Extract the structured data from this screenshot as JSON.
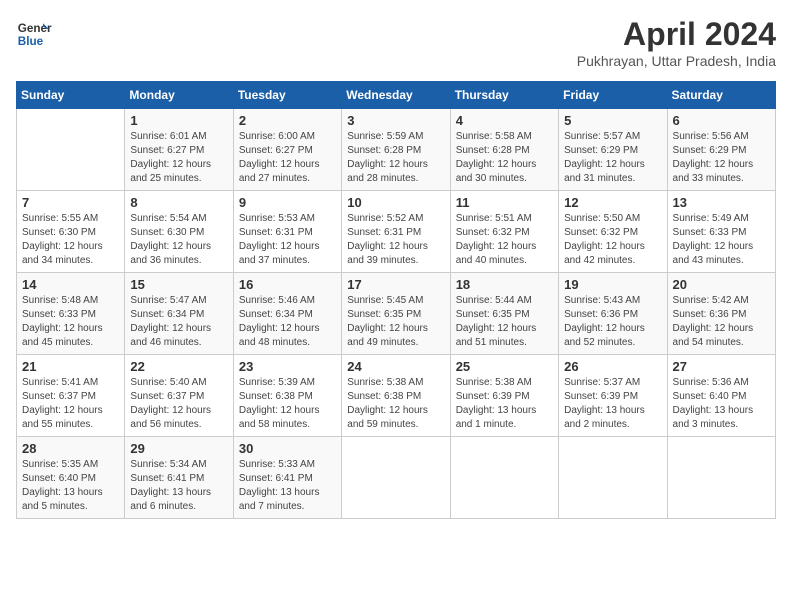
{
  "header": {
    "logo_line1": "General",
    "logo_line2": "Blue",
    "month_title": "April 2024",
    "subtitle": "Pukhrayan, Uttar Pradesh, India"
  },
  "days_of_week": [
    "Sunday",
    "Monday",
    "Tuesday",
    "Wednesday",
    "Thursday",
    "Friday",
    "Saturday"
  ],
  "weeks": [
    [
      {
        "num": "",
        "info": ""
      },
      {
        "num": "1",
        "info": "Sunrise: 6:01 AM\nSunset: 6:27 PM\nDaylight: 12 hours\nand 25 minutes."
      },
      {
        "num": "2",
        "info": "Sunrise: 6:00 AM\nSunset: 6:27 PM\nDaylight: 12 hours\nand 27 minutes."
      },
      {
        "num": "3",
        "info": "Sunrise: 5:59 AM\nSunset: 6:28 PM\nDaylight: 12 hours\nand 28 minutes."
      },
      {
        "num": "4",
        "info": "Sunrise: 5:58 AM\nSunset: 6:28 PM\nDaylight: 12 hours\nand 30 minutes."
      },
      {
        "num": "5",
        "info": "Sunrise: 5:57 AM\nSunset: 6:29 PM\nDaylight: 12 hours\nand 31 minutes."
      },
      {
        "num": "6",
        "info": "Sunrise: 5:56 AM\nSunset: 6:29 PM\nDaylight: 12 hours\nand 33 minutes."
      }
    ],
    [
      {
        "num": "7",
        "info": "Sunrise: 5:55 AM\nSunset: 6:30 PM\nDaylight: 12 hours\nand 34 minutes."
      },
      {
        "num": "8",
        "info": "Sunrise: 5:54 AM\nSunset: 6:30 PM\nDaylight: 12 hours\nand 36 minutes."
      },
      {
        "num": "9",
        "info": "Sunrise: 5:53 AM\nSunset: 6:31 PM\nDaylight: 12 hours\nand 37 minutes."
      },
      {
        "num": "10",
        "info": "Sunrise: 5:52 AM\nSunset: 6:31 PM\nDaylight: 12 hours\nand 39 minutes."
      },
      {
        "num": "11",
        "info": "Sunrise: 5:51 AM\nSunset: 6:32 PM\nDaylight: 12 hours\nand 40 minutes."
      },
      {
        "num": "12",
        "info": "Sunrise: 5:50 AM\nSunset: 6:32 PM\nDaylight: 12 hours\nand 42 minutes."
      },
      {
        "num": "13",
        "info": "Sunrise: 5:49 AM\nSunset: 6:33 PM\nDaylight: 12 hours\nand 43 minutes."
      }
    ],
    [
      {
        "num": "14",
        "info": "Sunrise: 5:48 AM\nSunset: 6:33 PM\nDaylight: 12 hours\nand 45 minutes."
      },
      {
        "num": "15",
        "info": "Sunrise: 5:47 AM\nSunset: 6:34 PM\nDaylight: 12 hours\nand 46 minutes."
      },
      {
        "num": "16",
        "info": "Sunrise: 5:46 AM\nSunset: 6:34 PM\nDaylight: 12 hours\nand 48 minutes."
      },
      {
        "num": "17",
        "info": "Sunrise: 5:45 AM\nSunset: 6:35 PM\nDaylight: 12 hours\nand 49 minutes."
      },
      {
        "num": "18",
        "info": "Sunrise: 5:44 AM\nSunset: 6:35 PM\nDaylight: 12 hours\nand 51 minutes."
      },
      {
        "num": "19",
        "info": "Sunrise: 5:43 AM\nSunset: 6:36 PM\nDaylight: 12 hours\nand 52 minutes."
      },
      {
        "num": "20",
        "info": "Sunrise: 5:42 AM\nSunset: 6:36 PM\nDaylight: 12 hours\nand 54 minutes."
      }
    ],
    [
      {
        "num": "21",
        "info": "Sunrise: 5:41 AM\nSunset: 6:37 PM\nDaylight: 12 hours\nand 55 minutes."
      },
      {
        "num": "22",
        "info": "Sunrise: 5:40 AM\nSunset: 6:37 PM\nDaylight: 12 hours\nand 56 minutes."
      },
      {
        "num": "23",
        "info": "Sunrise: 5:39 AM\nSunset: 6:38 PM\nDaylight: 12 hours\nand 58 minutes."
      },
      {
        "num": "24",
        "info": "Sunrise: 5:38 AM\nSunset: 6:38 PM\nDaylight: 12 hours\nand 59 minutes."
      },
      {
        "num": "25",
        "info": "Sunrise: 5:38 AM\nSunset: 6:39 PM\nDaylight: 13 hours\nand 1 minute."
      },
      {
        "num": "26",
        "info": "Sunrise: 5:37 AM\nSunset: 6:39 PM\nDaylight: 13 hours\nand 2 minutes."
      },
      {
        "num": "27",
        "info": "Sunrise: 5:36 AM\nSunset: 6:40 PM\nDaylight: 13 hours\nand 3 minutes."
      }
    ],
    [
      {
        "num": "28",
        "info": "Sunrise: 5:35 AM\nSunset: 6:40 PM\nDaylight: 13 hours\nand 5 minutes."
      },
      {
        "num": "29",
        "info": "Sunrise: 5:34 AM\nSunset: 6:41 PM\nDaylight: 13 hours\nand 6 minutes."
      },
      {
        "num": "30",
        "info": "Sunrise: 5:33 AM\nSunset: 6:41 PM\nDaylight: 13 hours\nand 7 minutes."
      },
      {
        "num": "",
        "info": ""
      },
      {
        "num": "",
        "info": ""
      },
      {
        "num": "",
        "info": ""
      },
      {
        "num": "",
        "info": ""
      }
    ]
  ]
}
